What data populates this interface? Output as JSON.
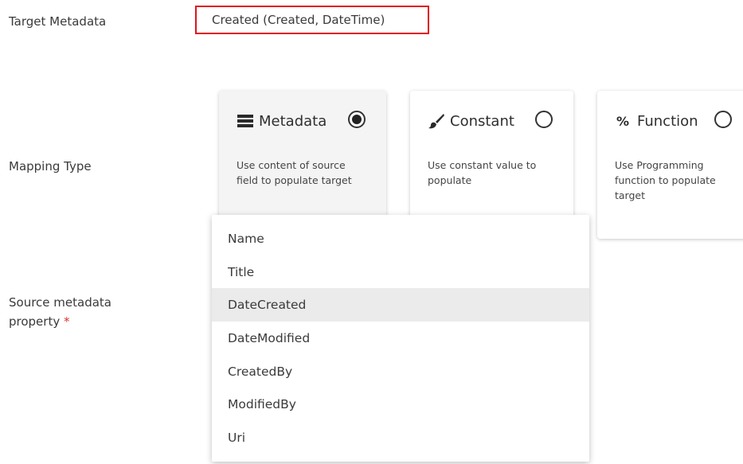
{
  "form": {
    "target_metadata_label": "Target Metadata",
    "target_metadata_value": "Created (Created, DateTime)",
    "mapping_type_label": "Mapping Type",
    "source_property_label_line1": "Source metadata",
    "source_property_label_line2": "property",
    "required_marker": "*"
  },
  "mapping_cards": [
    {
      "title": "Metadata",
      "icon": "list-icon",
      "selected": true,
      "desc_lines": [
        "Use content of source",
        "field to populate target"
      ]
    },
    {
      "title": "Constant",
      "icon": "brush-icon",
      "selected": false,
      "desc_lines": [
        "Use constant value to",
        "populate"
      ]
    },
    {
      "title": "Function",
      "icon": "function-icon",
      "selected": false,
      "desc_lines": [
        "Use Programming",
        "function to populate",
        "target"
      ]
    }
  ],
  "dropdown": {
    "options": [
      "Name",
      "Title",
      "DateCreated",
      "DateModified",
      "CreatedBy",
      "ModifiedBy",
      "Uri"
    ],
    "highlighted": "DateCreated"
  },
  "colors": {
    "highlight_border": "#e0141e",
    "required": "#d9342b",
    "option_hover": "#ebebeb"
  }
}
